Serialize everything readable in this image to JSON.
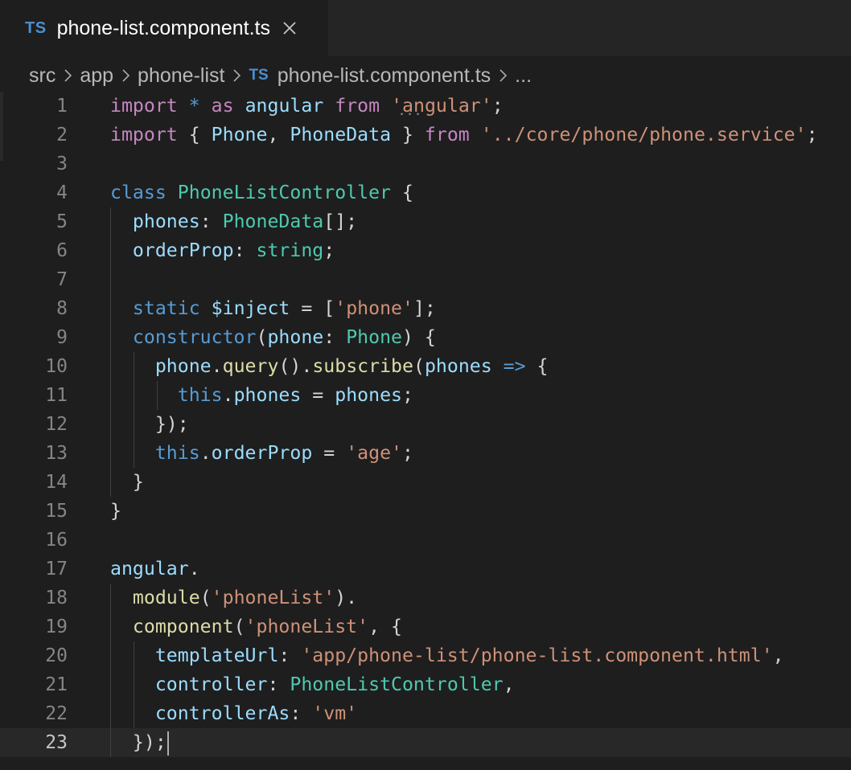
{
  "tab": {
    "badge": "TS",
    "title": "phone-list.component.ts",
    "close_icon": "close-icon"
  },
  "breadcrumb": {
    "items": [
      "src",
      "app",
      "phone-list"
    ],
    "file_badge": "TS",
    "file": "phone-list.component.ts",
    "trailing": "..."
  },
  "colors": {
    "keyword": "#c586c0",
    "storage": "#569cd6",
    "variable": "#9cdcfe",
    "type": "#4ec9b0",
    "string": "#ce9178",
    "function": "#dcdcaa",
    "punctuation": "#d4d4d4",
    "line_number": "#858585",
    "background": "#1e1e1e"
  },
  "code": {
    "active_line": 23,
    "lines": [
      {
        "n": "1",
        "indent": 0,
        "tokens": [
          [
            "kw",
            "import"
          ],
          [
            "pun",
            " "
          ],
          [
            "kb",
            "*"
          ],
          [
            "pun",
            " "
          ],
          [
            "kw",
            "as"
          ],
          [
            "pun",
            " "
          ],
          [
            "var",
            "angular"
          ],
          [
            "pun",
            " "
          ],
          [
            "kw",
            "from"
          ],
          [
            "pun",
            " "
          ],
          [
            "str",
            "'angular'"
          ],
          [
            "pun",
            ";"
          ]
        ]
      },
      {
        "n": "2",
        "indent": 0,
        "tokens": [
          [
            "kw",
            "import"
          ],
          [
            "pun",
            " { "
          ],
          [
            "var",
            "Phone"
          ],
          [
            "pun",
            ", "
          ],
          [
            "var",
            "PhoneData"
          ],
          [
            "pun",
            " } "
          ],
          [
            "kw",
            "from"
          ],
          [
            "pun",
            " "
          ],
          [
            "str",
            "'../core/phone/phone.service'"
          ],
          [
            "pun",
            ";"
          ]
        ]
      },
      {
        "n": "3",
        "indent": 0,
        "tokens": []
      },
      {
        "n": "4",
        "indent": 0,
        "tokens": [
          [
            "kb",
            "class"
          ],
          [
            "pun",
            " "
          ],
          [
            "cls",
            "PhoneListController"
          ],
          [
            "pun",
            " {"
          ]
        ]
      },
      {
        "n": "5",
        "indent": 1,
        "tokens": [
          [
            "var",
            "phones"
          ],
          [
            "pun",
            ": "
          ],
          [
            "cls",
            "PhoneData"
          ],
          [
            "pun",
            "[];"
          ]
        ]
      },
      {
        "n": "6",
        "indent": 1,
        "tokens": [
          [
            "var",
            "orderProp"
          ],
          [
            "pun",
            ": "
          ],
          [
            "cls",
            "string"
          ],
          [
            "pun",
            ";"
          ]
        ]
      },
      {
        "n": "7",
        "indent": 1,
        "tokens": []
      },
      {
        "n": "8",
        "indent": 1,
        "tokens": [
          [
            "kb",
            "static"
          ],
          [
            "pun",
            " "
          ],
          [
            "var",
            "$inject"
          ],
          [
            "pun",
            " = ["
          ],
          [
            "str",
            "'phone'"
          ],
          [
            "pun",
            "];"
          ]
        ]
      },
      {
        "n": "9",
        "indent": 1,
        "tokens": [
          [
            "kb",
            "constructor"
          ],
          [
            "pun",
            "("
          ],
          [
            "var",
            "phone"
          ],
          [
            "pun",
            ": "
          ],
          [
            "cls",
            "Phone"
          ],
          [
            "pun",
            ") {"
          ]
        ]
      },
      {
        "n": "10",
        "indent": 2,
        "tokens": [
          [
            "var",
            "phone"
          ],
          [
            "pun",
            "."
          ],
          [
            "fn",
            "query"
          ],
          [
            "pun",
            "()."
          ],
          [
            "fn",
            "subscribe"
          ],
          [
            "pun",
            "("
          ],
          [
            "var",
            "phones"
          ],
          [
            "pun",
            " "
          ],
          [
            "kb",
            "=>"
          ],
          [
            "pun",
            " {"
          ]
        ]
      },
      {
        "n": "11",
        "indent": 3,
        "tokens": [
          [
            "kb",
            "this"
          ],
          [
            "pun",
            "."
          ],
          [
            "var",
            "phones"
          ],
          [
            "pun",
            " = "
          ],
          [
            "var",
            "phones"
          ],
          [
            "pun",
            ";"
          ]
        ]
      },
      {
        "n": "12",
        "indent": 2,
        "tokens": [
          [
            "pun",
            "});"
          ]
        ]
      },
      {
        "n": "13",
        "indent": 2,
        "tokens": [
          [
            "kb",
            "this"
          ],
          [
            "pun",
            "."
          ],
          [
            "var",
            "orderProp"
          ],
          [
            "pun",
            " = "
          ],
          [
            "str",
            "'age'"
          ],
          [
            "pun",
            ";"
          ]
        ]
      },
      {
        "n": "14",
        "indent": 1,
        "tokens": [
          [
            "pun",
            "}"
          ]
        ]
      },
      {
        "n": "15",
        "indent": 0,
        "tokens": [
          [
            "pun",
            "}"
          ]
        ]
      },
      {
        "n": "16",
        "indent": 0,
        "tokens": []
      },
      {
        "n": "17",
        "indent": 0,
        "tokens": [
          [
            "var",
            "angular"
          ],
          [
            "pun",
            "."
          ]
        ]
      },
      {
        "n": "18",
        "indent": 1,
        "tokens": [
          [
            "fn",
            "module"
          ],
          [
            "pun",
            "("
          ],
          [
            "str",
            "'phoneList'"
          ],
          [
            "pun",
            ")."
          ]
        ]
      },
      {
        "n": "19",
        "indent": 1,
        "tokens": [
          [
            "fn",
            "component"
          ],
          [
            "pun",
            "("
          ],
          [
            "str",
            "'phoneList'"
          ],
          [
            "pun",
            ", {"
          ]
        ]
      },
      {
        "n": "20",
        "indent": 2,
        "tokens": [
          [
            "var",
            "templateUrl"
          ],
          [
            "pun",
            ": "
          ],
          [
            "str",
            "'app/phone-list/phone-list.component.html'"
          ],
          [
            "pun",
            ","
          ]
        ]
      },
      {
        "n": "21",
        "indent": 2,
        "tokens": [
          [
            "var",
            "controller"
          ],
          [
            "pun",
            ": "
          ],
          [
            "cls",
            "PhoneListController"
          ],
          [
            "pun",
            ","
          ]
        ]
      },
      {
        "n": "22",
        "indent": 2,
        "tokens": [
          [
            "var",
            "controllerAs"
          ],
          [
            "pun",
            ": "
          ],
          [
            "str",
            "'vm'"
          ]
        ]
      },
      {
        "n": "23",
        "indent": 1,
        "tokens": [
          [
            "pun",
            "});"
          ]
        ]
      }
    ],
    "guides": [
      {
        "from": 5,
        "to": 14,
        "level": 1
      },
      {
        "from": 10,
        "to": 13,
        "level": 2
      },
      {
        "from": 11,
        "to": 11,
        "level": 3
      },
      {
        "from": 18,
        "to": 23,
        "level": 1
      },
      {
        "from": 20,
        "to": 22,
        "level": 2
      }
    ]
  }
}
